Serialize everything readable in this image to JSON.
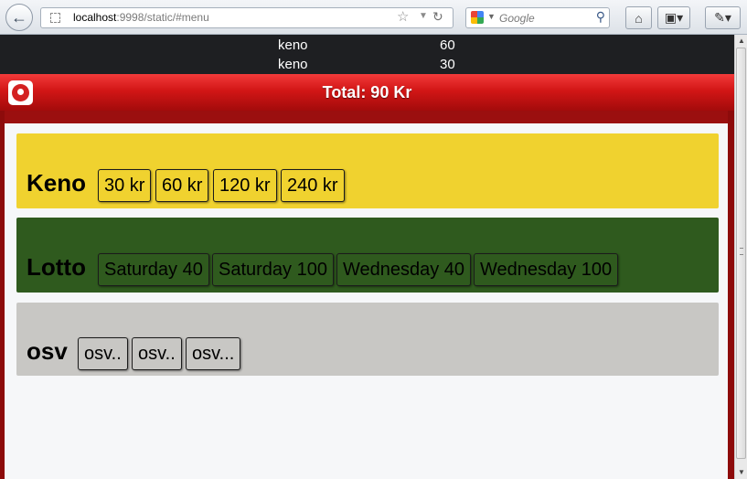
{
  "browser": {
    "url_host": "localhost",
    "url_rest": ":9998/static/#menu",
    "search_placeholder": "Google"
  },
  "orders": [
    {
      "name": "keno",
      "amount": "60"
    },
    {
      "name": "keno",
      "amount": "30"
    }
  ],
  "total": "Total: 90 Kr",
  "sections": [
    {
      "title": "Keno",
      "buttons": [
        "30 kr",
        "60 kr",
        "120 kr",
        "240 kr"
      ]
    },
    {
      "title": "Lotto",
      "buttons": [
        "Saturday 40",
        "Saturday 100",
        "Wednesday 40",
        "Wednesday 100"
      ]
    },
    {
      "title": "osv",
      "buttons": [
        "osv..",
        "osv..",
        "osv..."
      ]
    }
  ],
  "colors": {
    "keno": "#f0d22f",
    "lotto": "#2f5a1e",
    "osv": "#c8c7c4",
    "header_red": "#d21616",
    "orders_bg": "#1e1f22"
  },
  "icons": {
    "back": "back-arrow-icon",
    "bookmark": "star-icon",
    "reload": "reload-icon",
    "search": "magnifier-icon",
    "home": "home-icon",
    "bookmarks_menu": "bookmarks-icon",
    "addon": "addon-icon",
    "logo": "svenska-spel-logo"
  }
}
